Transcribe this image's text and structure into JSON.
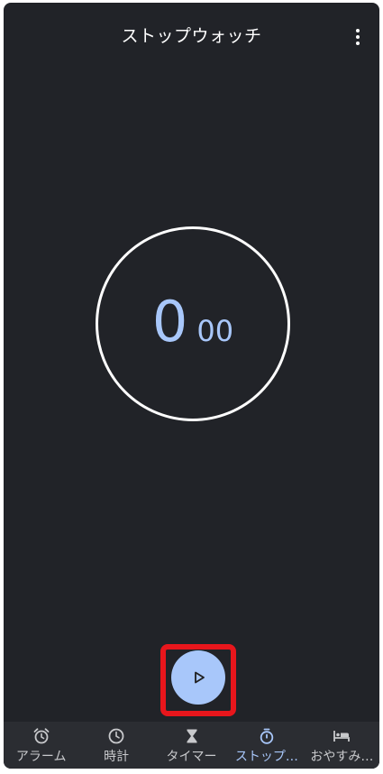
{
  "app": {
    "title": "ストップウォッチ"
  },
  "stopwatch": {
    "seconds": "0",
    "centiseconds": "00"
  },
  "nav": {
    "items": [
      {
        "label": "アラーム",
        "icon": "alarm-icon"
      },
      {
        "label": "時計",
        "icon": "clock-icon"
      },
      {
        "label": "タイマー",
        "icon": "hourglass-icon"
      },
      {
        "label": "ストップ…",
        "icon": "stopwatch-icon",
        "active": true
      },
      {
        "label": "おやすみ…",
        "icon": "bed-icon"
      }
    ]
  },
  "colors": {
    "background": "#212328",
    "accent": "#a8c7fa",
    "highlight": "#e8161c",
    "nav_background": "#2b2d32"
  }
}
